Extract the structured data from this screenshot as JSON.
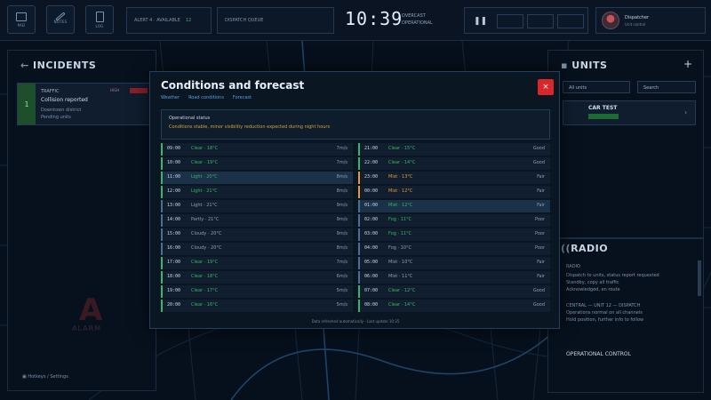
{
  "toolbar": {
    "buttons": [
      {
        "icon": "monitor-icon",
        "label": "PAD"
      },
      {
        "icon": "pen-icon",
        "label": "NOTES"
      },
      {
        "icon": "clipboard-icon",
        "label": "LOG"
      }
    ],
    "status_left": "ALERT 4 · AVAILABLE",
    "status_left_value": "12",
    "status_mid": "DISPATCH QUEUE",
    "clock": "10:39",
    "clock_meta_1": "OVERCAST",
    "clock_meta_2": "OPERATIONAL",
    "user_name": "Dispatcher",
    "user_sub": "Unit control"
  },
  "incidents_panel": {
    "title": "INCIDENTS",
    "incident": {
      "number": "1",
      "line1": "TRAFFIC",
      "line2": "Collision reported",
      "line3": "Downtown district",
      "line4": "Pending units",
      "tag": "HIGH"
    },
    "logo_text": "ALARM",
    "footer": "Hotkeys / Settings"
  },
  "units_panel": {
    "title": "UNITS",
    "filter": "All units",
    "search": "Search",
    "unit_name": "CAR TEST"
  },
  "radio_panel": {
    "title": "RADIO",
    "lines": [
      "RADIO",
      "Dispatch to units, status report requested",
      "Standby, copy all traffic",
      "Acknowledged, en route",
      "",
      "CENTRAL — UNIT 12 — DISPATCH",
      "Operations normal on all channels",
      "Hold position, further info to follow",
      "",
      "OPERATIONAL CONTROL"
    ]
  },
  "modal": {
    "title": "Conditions and forecast",
    "tabs": [
      "Weather",
      "Road conditions",
      "Forecast"
    ],
    "close_label": "×",
    "alert_title": "Operational status",
    "alert_text": "Conditions stable, minor visibility reduction expected during night hours",
    "left_rows": [
      {
        "time": "09:00",
        "cond": "Clear · 18°C",
        "val": "7m/s",
        "tone": "g",
        "ctone": "",
        "sel": false
      },
      {
        "time": "10:00",
        "cond": "Clear · 19°C",
        "val": "7m/s",
        "tone": "g",
        "ctone": "",
        "sel": false
      },
      {
        "time": "11:00",
        "cond": "Light · 20°C",
        "val": "8m/s",
        "tone": "g",
        "ctone": "",
        "sel": true
      },
      {
        "time": "12:00",
        "cond": "Light · 21°C",
        "val": "8m/s",
        "tone": "g",
        "ctone": "",
        "sel": false
      },
      {
        "time": "13:00",
        "cond": "Light · 21°C",
        "val": "9m/s",
        "tone": "b",
        "ctone": "gry",
        "sel": false
      },
      {
        "time": "14:00",
        "cond": "Partly · 21°C",
        "val": "9m/s",
        "tone": "b",
        "ctone": "gry",
        "sel": false
      },
      {
        "time": "15:00",
        "cond": "Cloudy · 20°C",
        "val": "9m/s",
        "tone": "b",
        "ctone": "gry",
        "sel": false
      },
      {
        "time": "16:00",
        "cond": "Cloudy · 20°C",
        "val": "8m/s",
        "tone": "b",
        "ctone": "gry",
        "sel": false
      },
      {
        "time": "17:00",
        "cond": "Clear · 19°C",
        "val": "7m/s",
        "tone": "g",
        "ctone": "",
        "sel": false
      },
      {
        "time": "18:00",
        "cond": "Clear · 18°C",
        "val": "6m/s",
        "tone": "g",
        "ctone": "",
        "sel": false
      },
      {
        "time": "19:00",
        "cond": "Clear · 17°C",
        "val": "5m/s",
        "tone": "g",
        "ctone": "",
        "sel": false
      },
      {
        "time": "20:00",
        "cond": "Clear · 16°C",
        "val": "5m/s",
        "tone": "g",
        "ctone": "",
        "sel": false
      }
    ],
    "right_rows": [
      {
        "time": "21:00",
        "cond": "Clear · 15°C",
        "val": "Good",
        "tone": "g",
        "ctone": "",
        "sel": false
      },
      {
        "time": "22:00",
        "cond": "Clear · 14°C",
        "val": "Good",
        "tone": "g",
        "ctone": "",
        "sel": false
      },
      {
        "time": "23:00",
        "cond": "Mist · 13°C",
        "val": "Fair",
        "tone": "o",
        "ctone": "ora",
        "sel": false
      },
      {
        "time": "00:00",
        "cond": "Mist · 12°C",
        "val": "Fair",
        "tone": "o",
        "ctone": "ora",
        "sel": false
      },
      {
        "time": "01:00",
        "cond": "Mist · 12°C",
        "val": "Fair",
        "tone": "b",
        "ctone": "",
        "sel": true
      },
      {
        "time": "02:00",
        "cond": "Fog · 11°C",
        "val": "Poor",
        "tone": "b",
        "ctone": "",
        "sel": false
      },
      {
        "time": "03:00",
        "cond": "Fog · 11°C",
        "val": "Poor",
        "tone": "b",
        "ctone": "",
        "sel": false
      },
      {
        "time": "04:00",
        "cond": "Fog · 10°C",
        "val": "Poor",
        "tone": "b",
        "ctone": "gry",
        "sel": false
      },
      {
        "time": "05:00",
        "cond": "Mist · 10°C",
        "val": "Fair",
        "tone": "b",
        "ctone": "gry",
        "sel": false
      },
      {
        "time": "06:00",
        "cond": "Mist · 11°C",
        "val": "Fair",
        "tone": "b",
        "ctone": "gry",
        "sel": false
      },
      {
        "time": "07:00",
        "cond": "Clear · 12°C",
        "val": "Good",
        "tone": "g",
        "ctone": "",
        "sel": false
      },
      {
        "time": "08:00",
        "cond": "Clear · 14°C",
        "val": "Good",
        "tone": "g",
        "ctone": "",
        "sel": false
      }
    ],
    "footer": "Data refreshed automatically · Last update 10:35"
  },
  "colors": {
    "accent": "#4ea3e0",
    "good": "#3bb56a",
    "warn": "#e39b34",
    "danger": "#d9262b"
  }
}
